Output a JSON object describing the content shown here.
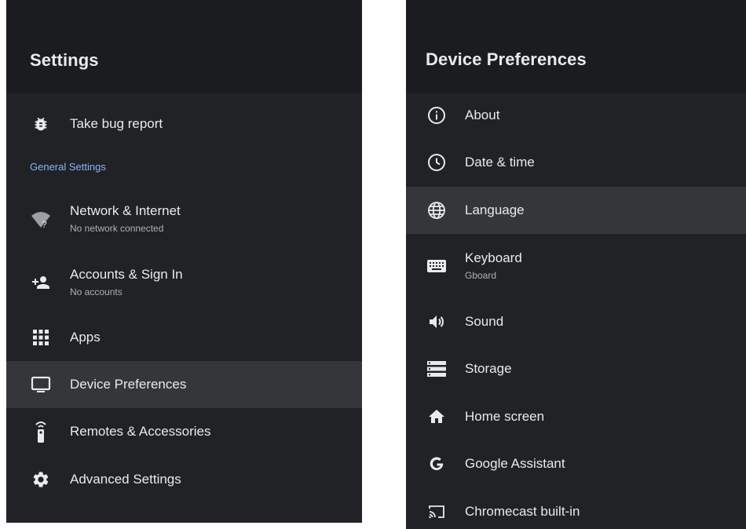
{
  "left": {
    "title": "Settings",
    "bug_report": {
      "label": "Take bug report",
      "icon": "bug-icon"
    },
    "section_label": "General Settings",
    "items": [
      {
        "label": "Network & Internet",
        "sub": "No network connected",
        "icon": "wifi-off-icon"
      },
      {
        "label": "Accounts & Sign In",
        "sub": "No accounts",
        "icon": "add-person-icon"
      },
      {
        "label": "Apps",
        "icon": "apps-grid-icon"
      },
      {
        "label": "Device Preferences",
        "icon": "tv-icon",
        "selected": true
      },
      {
        "label": "Remotes & Accessories",
        "icon": "remote-icon"
      },
      {
        "label": "Advanced Settings",
        "icon": "gear-icon"
      }
    ]
  },
  "right": {
    "title": "Device Preferences",
    "items": [
      {
        "label": "About",
        "icon": "info-icon"
      },
      {
        "label": "Date & time",
        "icon": "clock-icon"
      },
      {
        "label": "Language",
        "icon": "globe-icon",
        "selected": true
      },
      {
        "label": "Keyboard",
        "sub": "Gboard",
        "icon": "keyboard-icon"
      },
      {
        "label": "Sound",
        "icon": "speaker-icon"
      },
      {
        "label": "Storage",
        "icon": "storage-icon"
      },
      {
        "label": "Home screen",
        "icon": "home-icon"
      },
      {
        "label": "Google Assistant",
        "icon": "google-icon"
      },
      {
        "label": "Chromecast built-in",
        "icon": "cast-icon"
      }
    ]
  },
  "colors": {
    "panel_bg": "#212226",
    "header_bg": "#1b1c1f",
    "selected_bg": "#35363a",
    "text_primary": "#e8eaed",
    "text_secondary": "#aeb0b4",
    "accent": "#8ab4f8"
  }
}
